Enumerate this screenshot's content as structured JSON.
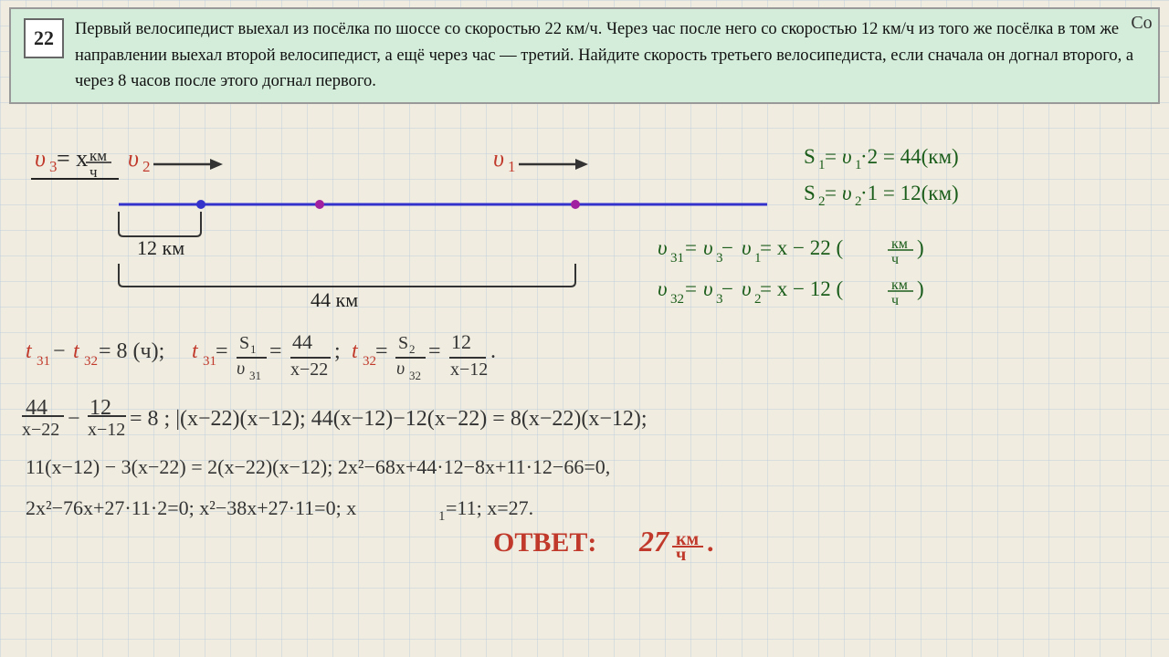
{
  "problem": {
    "number": "22",
    "text": "Первый велосипедист выехал из посёлка по шоссе со скоростью 22 км/ч. Через час после него со скоростью 12 км/ч из того же посёлка в том же направлении выехал второй велосипедист, а ещё через час — третий. Найдите скорость третьего велосипедиста, если сначала он догнал второго, а через 8 часов после этого догнал первого."
  },
  "top_right": {
    "label": "Co"
  }
}
